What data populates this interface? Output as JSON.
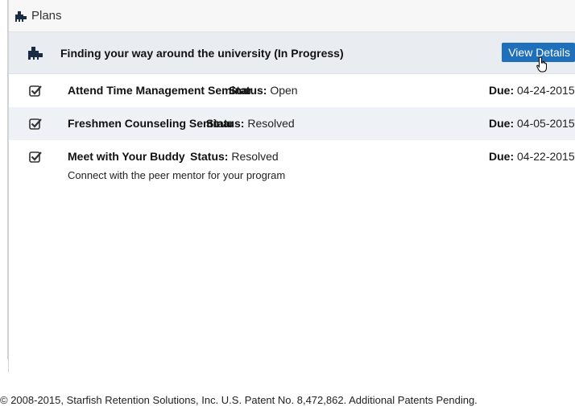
{
  "header": {
    "title": "Plans",
    "icon": "puzzle-icon"
  },
  "plan": {
    "title": "Finding your way around the university (In Progress)",
    "view_details_label": "View Details",
    "icon": "puzzle-icon"
  },
  "tasks": [
    {
      "name": "Attend Time Management Seminar",
      "status_label": "Status:",
      "status": "Open",
      "due_label": "Due:",
      "due": "04-24-2015",
      "description": ""
    },
    {
      "name": "Freshmen Counseling Seminar",
      "status_label": "Status:",
      "status": "Resolved",
      "due_label": "Due:",
      "due": "04-05-2015",
      "description": ""
    },
    {
      "name": "Meet with Your Buddy",
      "status_label": "Status:",
      "status": "Resolved",
      "due_label": "Due:",
      "due": "04-22-2015",
      "description": "Connect with the peer mentor for your program"
    }
  ],
  "footer": {
    "text": "© 2008-2015, Starfish Retention Solutions, Inc. U.S. Patent No. 8,472,862. Additional Patents Pending."
  },
  "colors": {
    "button": "#1f6fba",
    "plan_row": "#e9edf2",
    "alt_row": "#eef2f6",
    "icon": "#1a2c44"
  }
}
